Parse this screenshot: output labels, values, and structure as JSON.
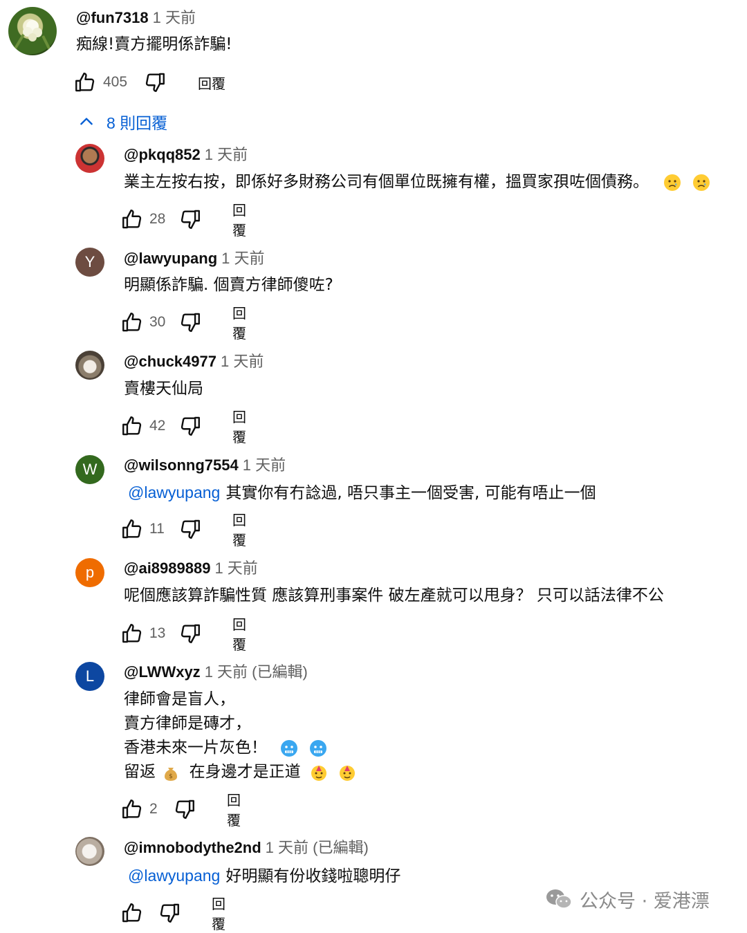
{
  "top_comment": {
    "author": "@fun7318",
    "time": "1 天前",
    "text": "痴線!賣方擺明係詐騙!",
    "likes": "405",
    "reply_label": "回覆"
  },
  "replies_toggle": {
    "label": "8 則回覆"
  },
  "replies": [
    {
      "author": "@pkqq852",
      "time": "1 天前",
      "lines": [
        "業主左按右按，即係好多財務公司有個單位既擁有權，搵買家孭咗個債務。"
      ],
      "likes": "28",
      "reply_label": "回覆",
      "emoji": [
        "crying-face",
        "crying-face"
      ]
    },
    {
      "author": "@lawyupang",
      "time": "1 天前",
      "avatar_letter": "Y",
      "lines": [
        "明顯係詐騙. 個賣方律師傻咗?"
      ],
      "likes": "30",
      "reply_label": "回覆"
    },
    {
      "author": "@chuck4977",
      "time": "1 天前",
      "lines": [
        "賣樓天仙局"
      ],
      "likes": "42",
      "reply_label": "回覆"
    },
    {
      "author": "@wilsonng7554",
      "time": "1 天前",
      "avatar_letter": "W",
      "mention": "@lawyupang",
      "lines": [
        "其實你有冇諗過, 唔只事主一個受害, 可能有唔止一個"
      ],
      "likes": "11",
      "reply_label": "回覆"
    },
    {
      "author": "@ai8989889",
      "time": "1 天前",
      "avatar_letter": "p",
      "lines": [
        "呢個應該算詐騙性質 應該算刑事案件 破左產就可以甩身？ 只可以話法律不公"
      ],
      "likes": "13",
      "reply_label": "回覆"
    },
    {
      "author": "@LWWxyz",
      "time": "1 天前 (已編輯)",
      "avatar_letter": "L",
      "lines": [
        "律師會是盲人，",
        "賣方律師是磚才，",
        "香港未來一片灰色！",
        "留返",
        "在身邊才是正道"
      ],
      "likes": "2",
      "reply_label": "回覆"
    },
    {
      "author": "@imnobodythe2nd",
      "time": "1 天前 (已編輯)",
      "mention": "@lawyupang",
      "lines": [
        "好明顯有份收錢啦聰明仔"
      ],
      "likes": "",
      "reply_label": "回覆"
    }
  ],
  "colors": {
    "link": "#065fd4",
    "secondary_text": "#606060",
    "avatar_y": "#6d4c41",
    "avatar_w": "#33691e",
    "avatar_p": "#ef6c00",
    "avatar_l": "#0d47a1"
  },
  "watermark": {
    "text": "公众号 · 爱港漂"
  }
}
